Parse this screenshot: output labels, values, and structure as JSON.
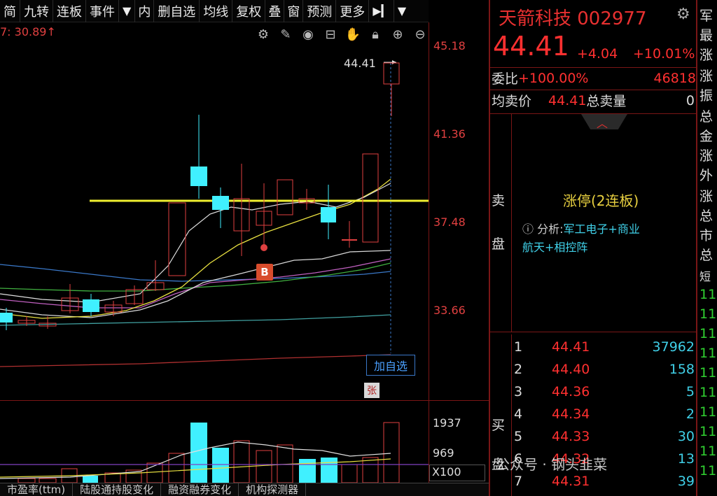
{
  "toolbar": {
    "items": [
      "简",
      "九转",
      "连板",
      "事件"
    ],
    "items2": [
      "内",
      "删自选",
      "均线",
      "复权",
      "叠",
      "窗",
      "预测",
      "更多"
    ]
  },
  "chart": {
    "ma_info": "7: 30.89↑",
    "limit_price_label": "44.41",
    "price_ticks": [
      "45.18",
      "41.36",
      "37.48",
      "33.66"
    ],
    "vol_ticks": [
      "1937",
      "969"
    ],
    "vol_unit": "X100",
    "add_favorite": "加自选",
    "zhang_mark": "张",
    "b_mark": "B",
    "icons": [
      "settings-icon",
      "pen-icon",
      "eye-icon",
      "basket-icon",
      "hand-icon",
      "lock-icon",
      "zoom-in-icon",
      "zoom-out-icon"
    ]
  },
  "bottom_tabs": [
    "市盈率(ttm)",
    "陆股通持股变化",
    "融资融券变化",
    "机构探测器"
  ],
  "quote": {
    "name_code": "天箭科技 002977",
    "price": "44.41",
    "change": "+4.04",
    "change_pct": "+10.01%",
    "weibi_label": "委比",
    "weibi_value": "+100.00%",
    "weicha_value": "46818",
    "avg_sell_label": "均卖价",
    "avg_sell_value": "44.41",
    "total_sell_label": "总卖量",
    "total_sell_value": "0"
  },
  "sell_panel": {
    "side_label_1": "卖",
    "side_label_2": "盘",
    "limit_tag": "涨停(2连板)",
    "analysis_prefix": "分析:",
    "analysis_1": "军工电子+商业",
    "analysis_2": "航天+相控阵"
  },
  "buy_panel": {
    "side_label_1": "买",
    "side_label_2": "盘",
    "rows": [
      {
        "level": "1",
        "price": "44.41",
        "volume": "37962"
      },
      {
        "level": "2",
        "price": "44.40",
        "volume": "158"
      },
      {
        "level": "3",
        "price": "44.36",
        "volume": "5"
      },
      {
        "level": "4",
        "price": "44.34",
        "volume": "2"
      },
      {
        "level": "5",
        "price": "44.33",
        "volume": "30"
      },
      {
        "level": "6",
        "price": "44.32",
        "volume": "13"
      },
      {
        "level": "7",
        "price": "44.31",
        "volume": "39"
      }
    ]
  },
  "strip": {
    "items": [
      "军",
      "最",
      "涨",
      "涨",
      "振",
      "总",
      "金",
      "涨",
      "外",
      "涨",
      "总",
      "市",
      "总",
      "短"
    ],
    "green_items": [
      "11",
      "11",
      "11",
      "11",
      "11",
      "11",
      "11",
      "11",
      "11",
      "11"
    ]
  },
  "watermark": "公众号 · 钢头韭菜",
  "colors": {
    "up": "#ff3030",
    "down": "#40f0ff",
    "limit_line": "#f0f030"
  }
}
